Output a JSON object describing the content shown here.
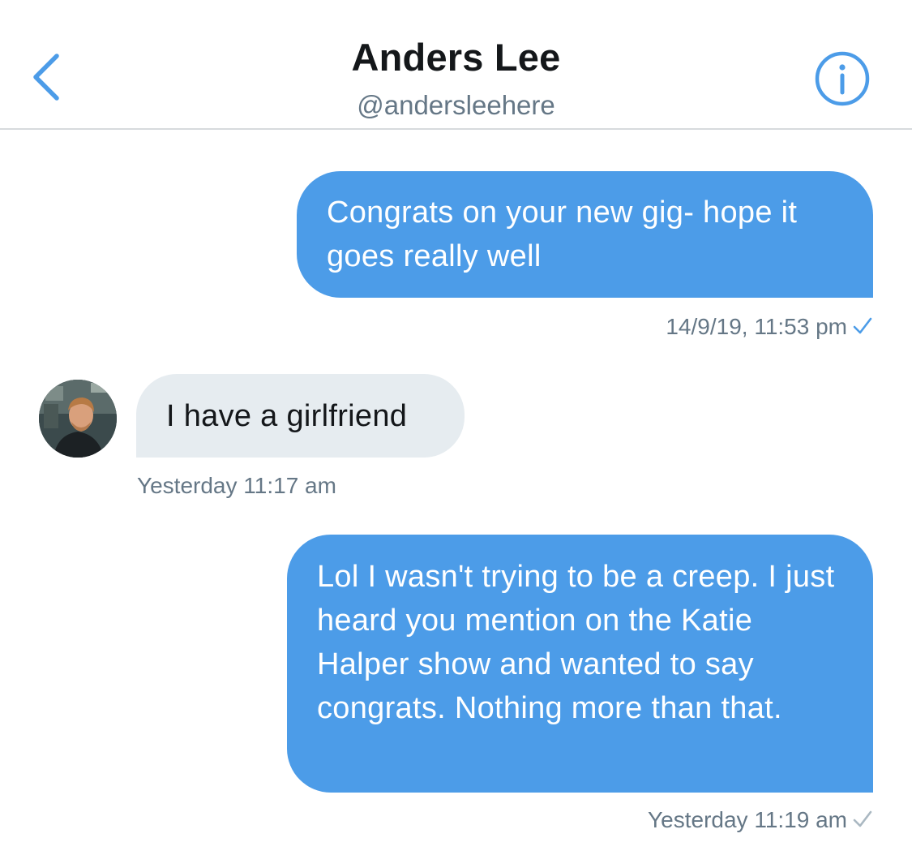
{
  "header": {
    "name": "Anders Lee",
    "handle": "@andersleehere",
    "back_icon": "chevron-left-icon",
    "info_icon": "info-icon"
  },
  "colors": {
    "accent": "#4c9ce8",
    "incoming_bubble": "#e6ecf0",
    "muted_text": "#657786",
    "divider": "#d7dadd"
  },
  "messages": [
    {
      "direction": "outgoing",
      "text": "Congrats on your new gig- hope it goes really well",
      "timestamp": "14/9/19, 11:53 pm",
      "status_icon": "checkmark-icon",
      "status_color": "#4c9ce8"
    },
    {
      "direction": "incoming",
      "text": "I have a girlfriend",
      "timestamp": "Yesterday 11:17 am"
    },
    {
      "direction": "outgoing",
      "text": "Lol I wasn't trying to be a creep. I just heard you mention on the Katie Halper show and wanted to say congrats. Nothing more than that.",
      "timestamp": "Yesterday 11:19 am",
      "status_icon": "checkmark-icon",
      "status_color": "#aab8c2"
    }
  ]
}
